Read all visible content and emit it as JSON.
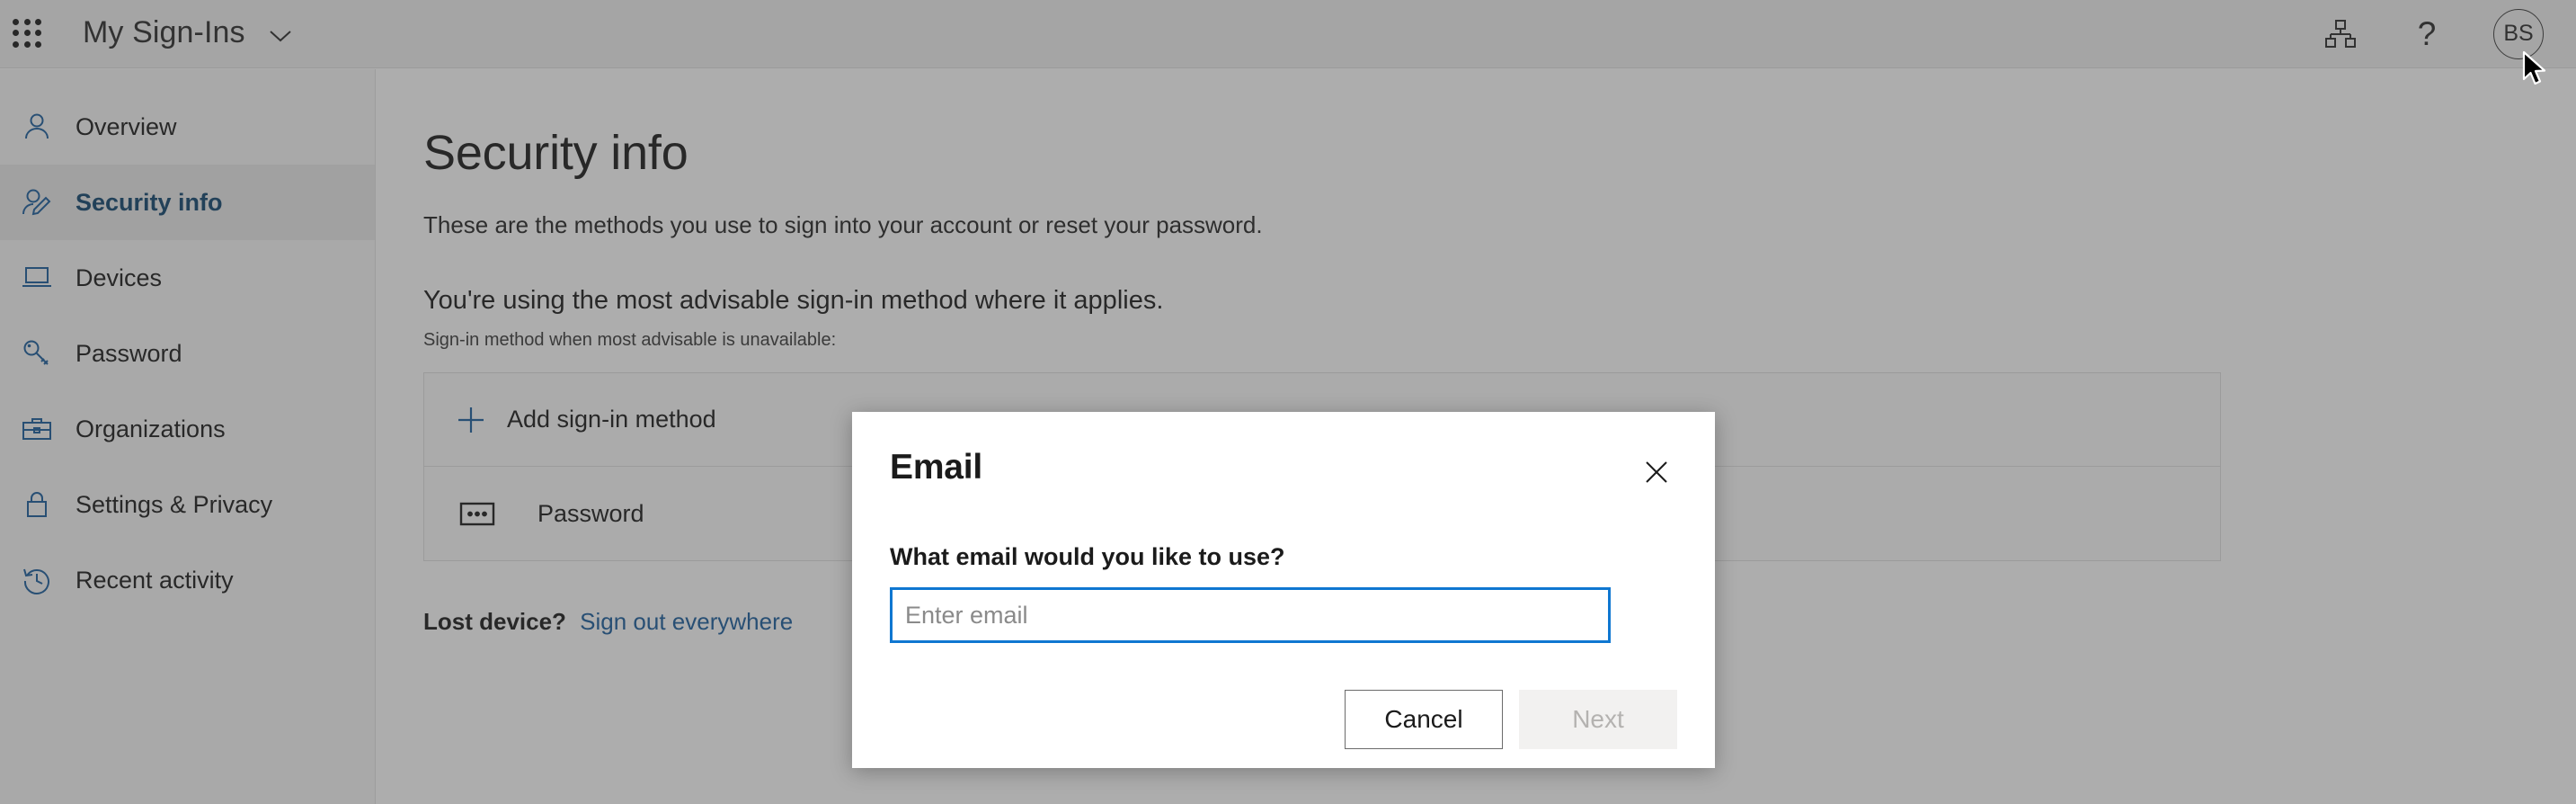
{
  "appbar": {
    "waffle_icon": "app-launcher-icon",
    "brand": "My Sign-Ins",
    "chevron_icon": "chevron-down-icon",
    "org_icon": "org-hierarchy-icon",
    "help_icon": "question-mark-icon",
    "help_label": "?",
    "avatar_initials": "BS"
  },
  "sidebar": {
    "items": [
      {
        "label": "Overview",
        "icon": "person-icon",
        "active": false
      },
      {
        "label": "Security info",
        "icon": "person-edit-icon",
        "active": true
      },
      {
        "label": "Devices",
        "icon": "laptop-icon",
        "active": false
      },
      {
        "label": "Password",
        "icon": "key-icon",
        "active": false
      },
      {
        "label": "Organizations",
        "icon": "briefcase-icon",
        "active": false
      },
      {
        "label": "Settings & Privacy",
        "icon": "lock-icon",
        "active": false
      },
      {
        "label": "Recent activity",
        "icon": "clock-history-icon",
        "active": false
      }
    ]
  },
  "main": {
    "title": "Security info",
    "subtitle": "These are the methods you use to sign into your account or reset your password.",
    "advisable_line": "You're using the most advisable sign-in method where it applies.",
    "advisable_note": "Sign-in method when most advisable is unavailable:",
    "add_method_label": "Add sign-in method",
    "add_method_icon": "plus-icon",
    "methods": [
      {
        "label": "Password",
        "icon": "password-dots-icon"
      }
    ],
    "lost_device_label": "Lost device?",
    "signout_link": "Sign out everywhere"
  },
  "modal": {
    "title": "Email",
    "close_icon": "close-icon",
    "prompt": "What email would you like to use?",
    "input_value": "",
    "input_placeholder": "Enter email",
    "cancel_label": "Cancel",
    "next_label": "Next"
  },
  "colors": {
    "accent_blue": "#1b5e9e",
    "focus_blue": "#0f77d1",
    "overlay": "rgba(60,60,60,.42)",
    "active_nav_bg": "#ebebeb",
    "disabled_button_bg": "#f2f1f0"
  }
}
